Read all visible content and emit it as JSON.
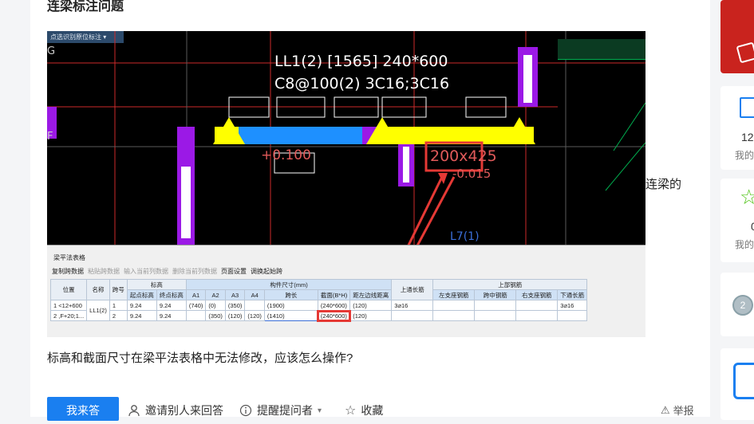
{
  "page": {
    "title": "连梁标注问题",
    "side_text": "连梁的",
    "question": "标高和截面尺寸在梁平法表格中无法修改，应该怎么操作?"
  },
  "actions": {
    "answer": "我来答",
    "invite": "邀请别人来回答",
    "remind": "提醒提问者",
    "collect": "收藏",
    "report": "举报"
  },
  "cad": {
    "toolbar_label": "点选识别原位标注",
    "beam_line1": "LL1(2) [1565] 240*600",
    "beam_line2": "C8@100(2) 3C16;3C16",
    "elev_label": "+0.100",
    "section_label": "200x425",
    "offset_label": "-0.015",
    "left_mark": "G",
    "left_mark2": "F",
    "l7_label": "L7(1)"
  },
  "table": {
    "window_title": "梁平法表格",
    "toolbar": [
      "复制跨数据",
      "粘贴跨数据",
      "输入当前列数据",
      "删除当前列数据",
      "页面设置",
      "调换起始跨"
    ],
    "group_headers": {
      "elev": "标高",
      "dims": "构件尺寸(mm)",
      "top_rebar": "上部钢筋"
    },
    "columns": [
      "位置",
      "名称",
      "跨号",
      "起点标高",
      "终点标高",
      "A1",
      "A2",
      "A3",
      "A4",
      "跨长",
      "截面(B*H)",
      "距左边线距离",
      "上通长筋",
      "左支座钢筋",
      "跨中钢筋",
      "右支座钢筋",
      "下通长筋"
    ],
    "rows": [
      {
        "idx": "1",
        "pos": "<12+600",
        "name": "LL1(2)",
        "span": "1",
        "start": "9.24",
        "end": "9.24",
        "a1": "(740)",
        "a2": "(0)",
        "a3": "(350)",
        "a4": "",
        "len": "(1900)",
        "section": "(240*600)",
        "dist": "(120)",
        "top": "3⌀16",
        "left": "",
        "mid": "",
        "right": "",
        "bottom": "3⌀16"
      },
      {
        "idx": "2",
        "pos": ",F+20;1...",
        "name": "",
        "span": "2",
        "start": "9.24",
        "end": "9.24",
        "a1": "",
        "a2": "(350)",
        "a3": "(120)",
        "a4": "(120)",
        "len": "(1410)",
        "section": "(240*600)",
        "dist": "(120)",
        "top": "",
        "left": "",
        "mid": "",
        "right": "",
        "bottom": ""
      }
    ]
  },
  "right_panel": {
    "count": "12",
    "mine1": "我的",
    "zero": "0",
    "mine2": "我的",
    "medal": "2"
  },
  "colors": {
    "accent": "#1a7ff0",
    "beam_yellow": "#ffff00",
    "beam_blue": "#1e90ff",
    "column_purple": "#9b19e6",
    "alert_red": "#e53935"
  }
}
